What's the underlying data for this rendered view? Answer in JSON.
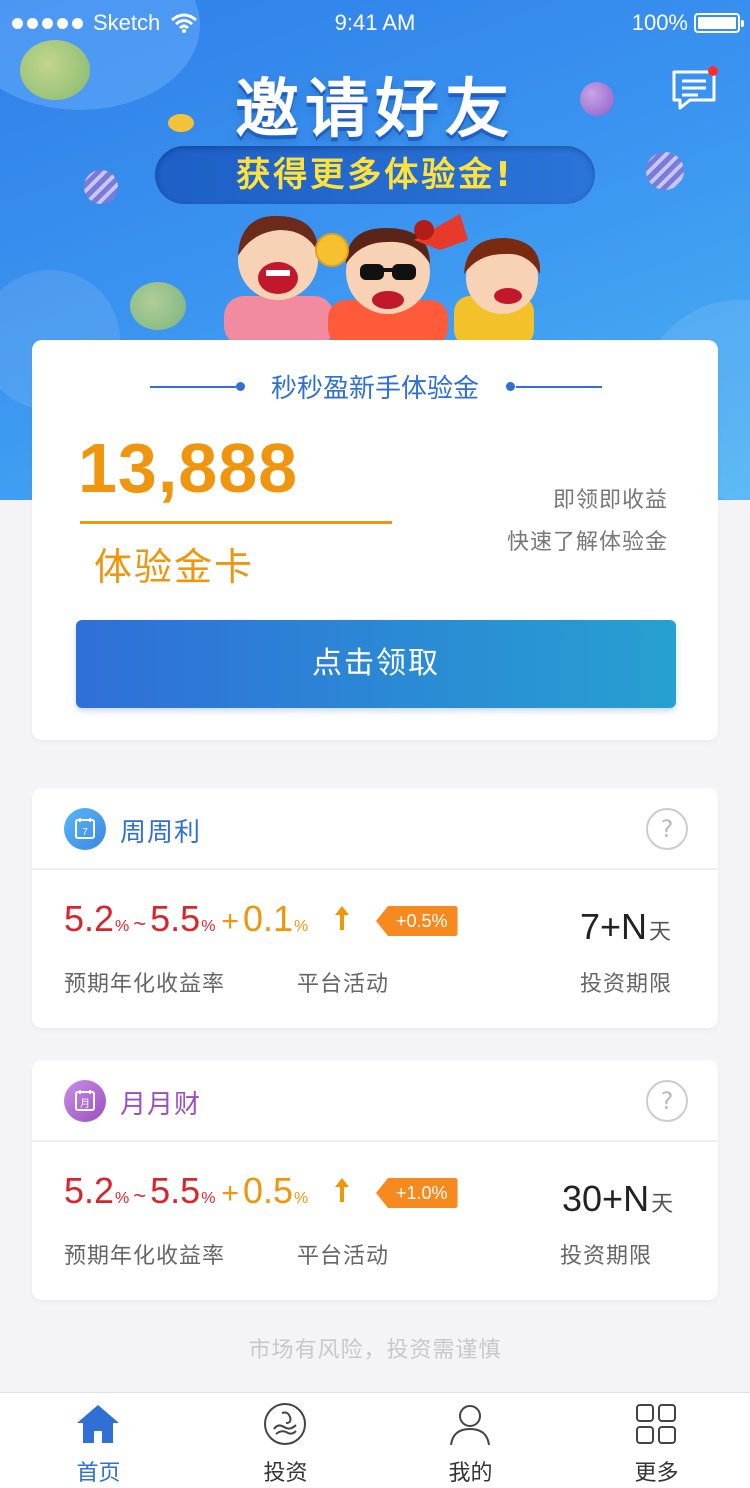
{
  "status_bar": {
    "carrier": "Sketch",
    "time": "9:41 AM",
    "battery": "100%"
  },
  "hero": {
    "title": "邀请好友",
    "subtitle": "获得更多体验金!"
  },
  "trial_card": {
    "heading": "秒秒盈新手体验金",
    "amount": "13,888",
    "card_label": "体验金卡",
    "benefit_line_1": "即领即收益",
    "benefit_line_2": "快速了解体验金",
    "claim_button": "点击领取"
  },
  "products": [
    {
      "name": "周周利",
      "icon": "calendar-week-icon",
      "icon_glyph": "7",
      "color": "#2f6fd6",
      "rate_min": "5.2",
      "rate_max": "5.5",
      "rate_unit": "%",
      "tilde": "~",
      "plus": "+",
      "rate_add": "0.1",
      "bonus": "+0.5%",
      "rate_label": "预期年化收益率",
      "activity_label": "平台活动",
      "period": "7+N",
      "period_unit": "天",
      "period_label": "投资期限"
    },
    {
      "name": "月月财",
      "icon": "calendar-month-icon",
      "icon_glyph": "月",
      "color": "#9b4fc0",
      "rate_min": "5.2",
      "rate_max": "5.5",
      "rate_unit": "%",
      "tilde": "~",
      "plus": "+",
      "rate_add": "0.5",
      "bonus": "+1.0%",
      "rate_label": "预期年化收益率",
      "activity_label": "平台活动",
      "period": "30+N",
      "period_unit": "天",
      "period_label": "投资期限"
    }
  ],
  "help_glyph": "?",
  "risk_notice": "市场有风险，投资需谨慎",
  "tabbar": [
    {
      "label": "首页",
      "icon": "home-icon",
      "active": true
    },
    {
      "label": "投资",
      "icon": "invest-icon",
      "active": false
    },
    {
      "label": "我的",
      "icon": "user-icon",
      "active": false
    },
    {
      "label": "更多",
      "icon": "grid-icon",
      "active": false
    }
  ],
  "colors": {
    "primary": "#2f6fd6",
    "accent_orange": "#f0960e",
    "rate_red": "#d9262a",
    "unread_dot": "#ff2d2d"
  }
}
